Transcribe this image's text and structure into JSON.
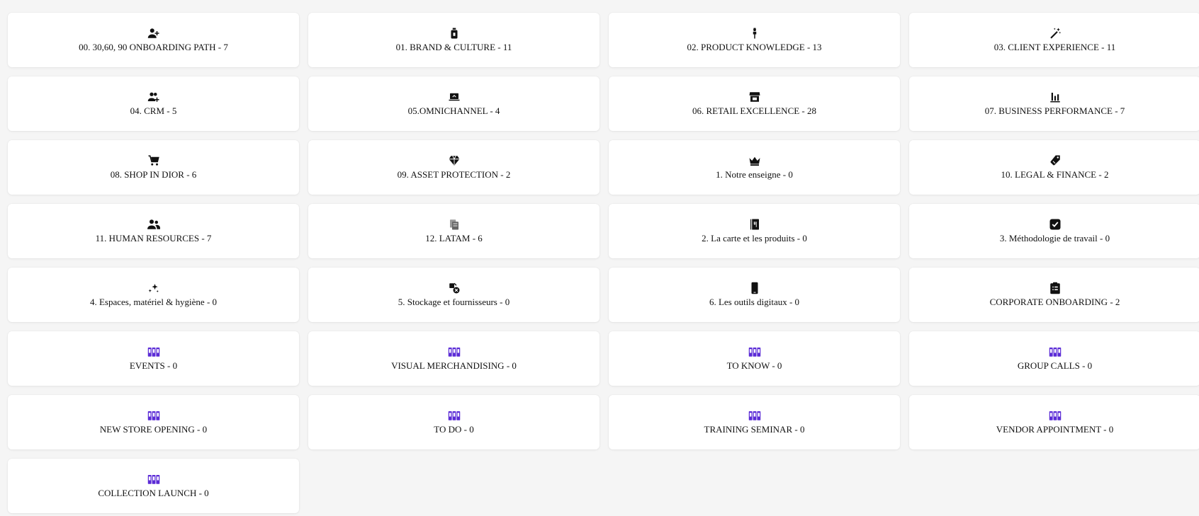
{
  "colors": {
    "background": "#f5f5f5",
    "card": "#ffffff",
    "icon": "#111111",
    "icon_grey": "#777777",
    "icon_purple": "#5b2bd6"
  },
  "categories": [
    {
      "label": "00. 30,60, 90 ONBOARDING PATH - 7",
      "icon": "person-add-icon"
    },
    {
      "label": "01. BRAND & CULTURE - 11",
      "icon": "perfume-bottle-icon"
    },
    {
      "label": "02. PRODUCT KNOWLEDGE - 13",
      "icon": "lipstick-icon"
    },
    {
      "label": "03. CLIENT EXPERIENCE - 11",
      "icon": "magic-wand-icon"
    },
    {
      "label": "04. CRM - 5",
      "icon": "group-add-icon"
    },
    {
      "label": "05.OMNICHANNEL - 4",
      "icon": "laptop-icon"
    },
    {
      "label": "06. RETAIL EXCELLENCE - 28",
      "icon": "storefront-icon"
    },
    {
      "label": "07. BUSINESS PERFORMANCE - 7",
      "icon": "bar-chart-icon"
    },
    {
      "label": "08. SHOP IN DIOR - 6",
      "icon": "shopping-cart-icon"
    },
    {
      "label": "09. ASSET PROTECTION - 2",
      "icon": "diamond-icon"
    },
    {
      "label": "1. Notre enseigne - 0",
      "icon": "crown-icon"
    },
    {
      "label": "10. LEGAL & FINANCE - 2",
      "icon": "price-tag-icon"
    },
    {
      "label": "11. HUMAN RESOURCES - 7",
      "icon": "people-icon"
    },
    {
      "label": "12. LATAM - 6",
      "icon": "documents-icon"
    },
    {
      "label": "2. La carte et les produits - 0",
      "icon": "menu-book-icon"
    },
    {
      "label": "3. Méthodologie de travail - 0",
      "icon": "checkbox-icon"
    },
    {
      "label": "4. Espaces, matériel & hygiène - 0",
      "icon": "sparkles-icon"
    },
    {
      "label": "5. Stockage et fournisseurs - 0",
      "icon": "supplies-icon"
    },
    {
      "label": "6. Les outils digitaux - 0",
      "icon": "smartphone-icon"
    },
    {
      "label": "CORPORATE ONBOARDING - 2",
      "icon": "clipboard-list-icon"
    },
    {
      "label": "EVENTS - 0",
      "icon": "binders-icon"
    },
    {
      "label": "VISUAL MERCHANDISING - 0",
      "icon": "binders-icon"
    },
    {
      "label": "TO KNOW - 0",
      "icon": "binders-icon"
    },
    {
      "label": "GROUP CALLS - 0",
      "icon": "binders-icon"
    },
    {
      "label": "NEW STORE OPENING - 0",
      "icon": "binders-icon"
    },
    {
      "label": "TO DO - 0",
      "icon": "binders-icon"
    },
    {
      "label": "TRAINING SEMINAR - 0",
      "icon": "binders-icon"
    },
    {
      "label": "VENDOR APPOINTMENT - 0",
      "icon": "binders-icon"
    },
    {
      "label": "COLLECTION LAUNCH - 0",
      "icon": "binders-icon"
    }
  ]
}
